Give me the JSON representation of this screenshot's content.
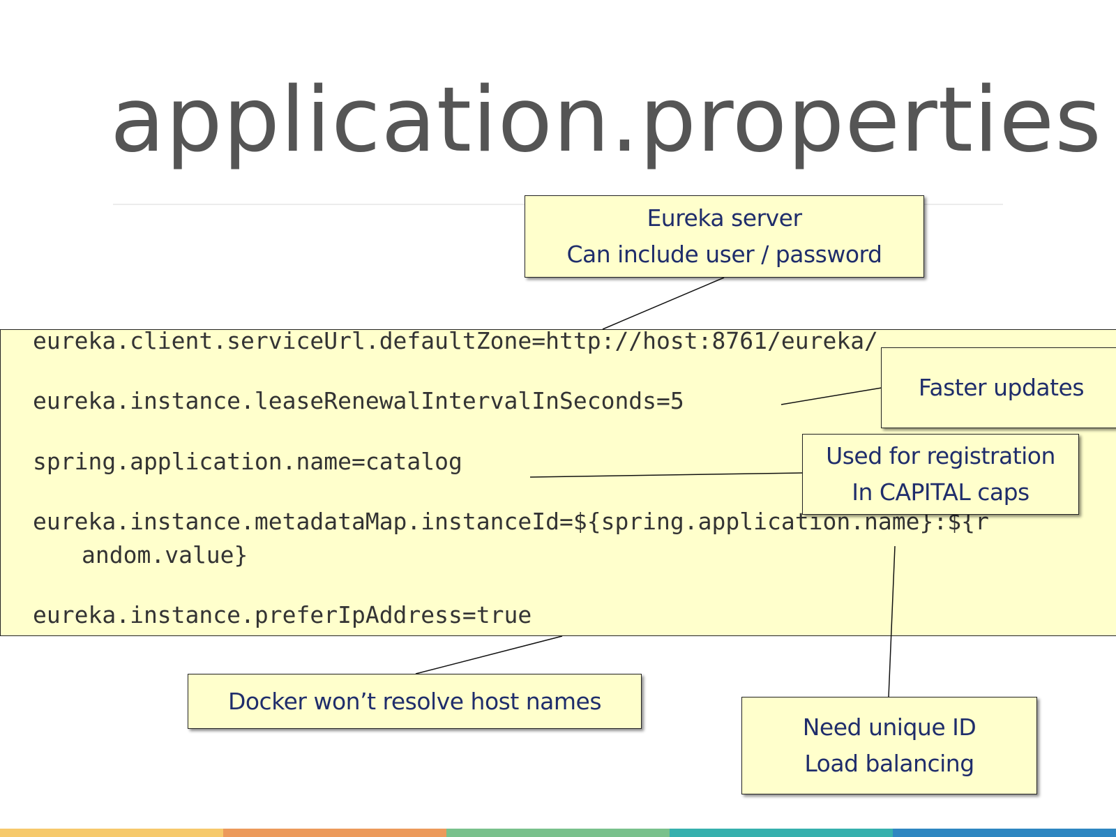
{
  "slide": {
    "title": "application.properties"
  },
  "code": {
    "line1": "eureka.client.serviceUrl.defaultZone=http://host:8761/eureka/",
    "line2": "eureka.instance.leaseRenewalIntervalInSeconds=5",
    "line3": "spring.application.name=catalog",
    "line4a": "eureka.instance.metadataMap.instanceId=${spring.application.name}:${r",
    "line4b": "andom.value}",
    "line5": "eureka.instance.preferIpAddress=true"
  },
  "callouts": {
    "eureka_server": {
      "line1": "Eureka server",
      "line2": "Can include user / password"
    },
    "faster_updates": {
      "line1": "Faster updates"
    },
    "registration": {
      "line1": "Used for registration",
      "line2": "In CAPITAL caps"
    },
    "docker": {
      "line1": "Docker won’t resolve host names"
    },
    "unique_id": {
      "line1": "Need unique ID",
      "line2": "Load balancing"
    }
  },
  "colors": {
    "callout_bg": "#ffffcc",
    "callout_text": "#1f2d6b",
    "title_text": "#555555",
    "footer": [
      "#f6c96b",
      "#ec9a5b",
      "#79c18c",
      "#36b0ad",
      "#2e86c1"
    ]
  }
}
